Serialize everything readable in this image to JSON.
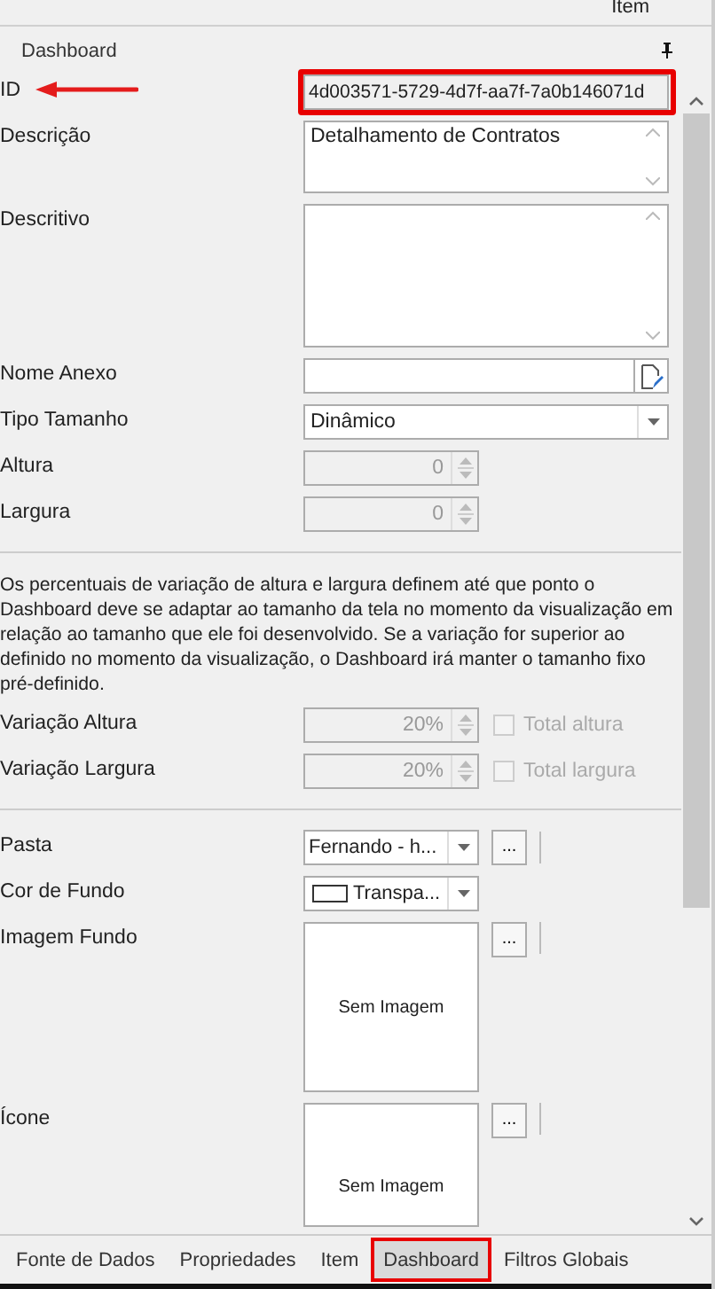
{
  "top_bar": {
    "label": "Item"
  },
  "panel": {
    "title": "Dashboard"
  },
  "rows": [
    {
      "kind": "text",
      "label": "ID",
      "value": "4d003571-5729-4d7f-aa7f-7a0b146071d",
      "highlighted": true
    },
    {
      "kind": "textarea",
      "label": "Descrição",
      "value": "Detalhamento de Contratos"
    },
    {
      "kind": "textarea",
      "label": "Descritivo"
    },
    {
      "kind": "file",
      "label": "Nome Anexo"
    },
    {
      "kind": "dropdown",
      "label": "Tipo Tamanho",
      "value": "Dinâmico"
    },
    {
      "kind": "spinner",
      "label": "Altura",
      "value": "0",
      "disabled": true
    },
    {
      "kind": "spinner",
      "label": "Largura",
      "value": "0",
      "disabled": true
    },
    {
      "kind": "divider"
    },
    {
      "kind": "note",
      "text": "Os percentuais de variação de altura e largura definem até que ponto o Dashboard deve se adaptar ao tamanho da tela no momento da visualização em relação ao tamanho que ele foi desenvolvido. Se a variação for superior ao definido no momento da visualização, o Dashboard irá manter o tamanho fixo pré-definido."
    },
    {
      "kind": "spinner",
      "label": "Variação Altura",
      "value": "20%",
      "disabled": true,
      "check": {
        "label": "Total altura",
        "checked": false,
        "disabled": true
      }
    },
    {
      "kind": "spinner",
      "label": "Variação Largura",
      "value": "20%",
      "disabled": true,
      "check": {
        "label": "Total largura",
        "checked": false,
        "disabled": true
      }
    },
    {
      "kind": "divider"
    },
    {
      "kind": "combo",
      "label": "Pasta",
      "value": "Fernando - h...",
      "button": "..."
    },
    {
      "kind": "color",
      "label": "Cor de Fundo",
      "value": "Transpa..."
    },
    {
      "kind": "image",
      "label": "Imagem Fundo",
      "placeholder": "Sem Imagem",
      "button": "..."
    },
    {
      "kind": "image",
      "label": "Ícone",
      "placeholder": "Sem Imagem",
      "button": "..."
    }
  ],
  "tabs": [
    {
      "label": "Fonte de Dados",
      "selected": false,
      "highlighted": false
    },
    {
      "label": "Propriedades",
      "selected": false,
      "highlighted": false
    },
    {
      "label": "Item",
      "selected": false,
      "highlighted": false
    },
    {
      "label": "Dashboard",
      "selected": true,
      "highlighted": true
    },
    {
      "label": "Filtros Globais",
      "selected": false,
      "highlighted": false
    }
  ]
}
